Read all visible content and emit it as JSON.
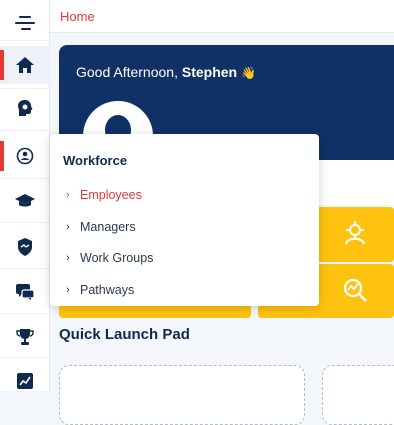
{
  "breadcrumb": {
    "home": "Home"
  },
  "hero": {
    "greeting": "Good Afternoon, ",
    "user_name": "Stephen",
    "wave": "👋"
  },
  "dropdown": {
    "title": "Workforce",
    "items": [
      {
        "label": "Employees",
        "active": true
      },
      {
        "label": "Managers",
        "active": false
      },
      {
        "label": "Work Groups",
        "active": false
      },
      {
        "label": "Pathways",
        "active": false
      }
    ]
  },
  "quick_launch": {
    "title": "Quick Launch Pad"
  },
  "sidebar": {
    "items": [
      {
        "icon": "menu-toggle-icon"
      },
      {
        "icon": "home-icon",
        "active": true
      },
      {
        "icon": "settings-head-icon"
      },
      {
        "icon": "workforce-icon"
      },
      {
        "icon": "graduation-cap-icon"
      },
      {
        "icon": "shield-handshake-icon"
      },
      {
        "icon": "chat-icon"
      },
      {
        "icon": "trophy-icon"
      },
      {
        "icon": "analytics-icon"
      }
    ]
  },
  "colors": {
    "accent": "#e53935",
    "navy": "#0f3166",
    "tile": "#ffc20e"
  }
}
